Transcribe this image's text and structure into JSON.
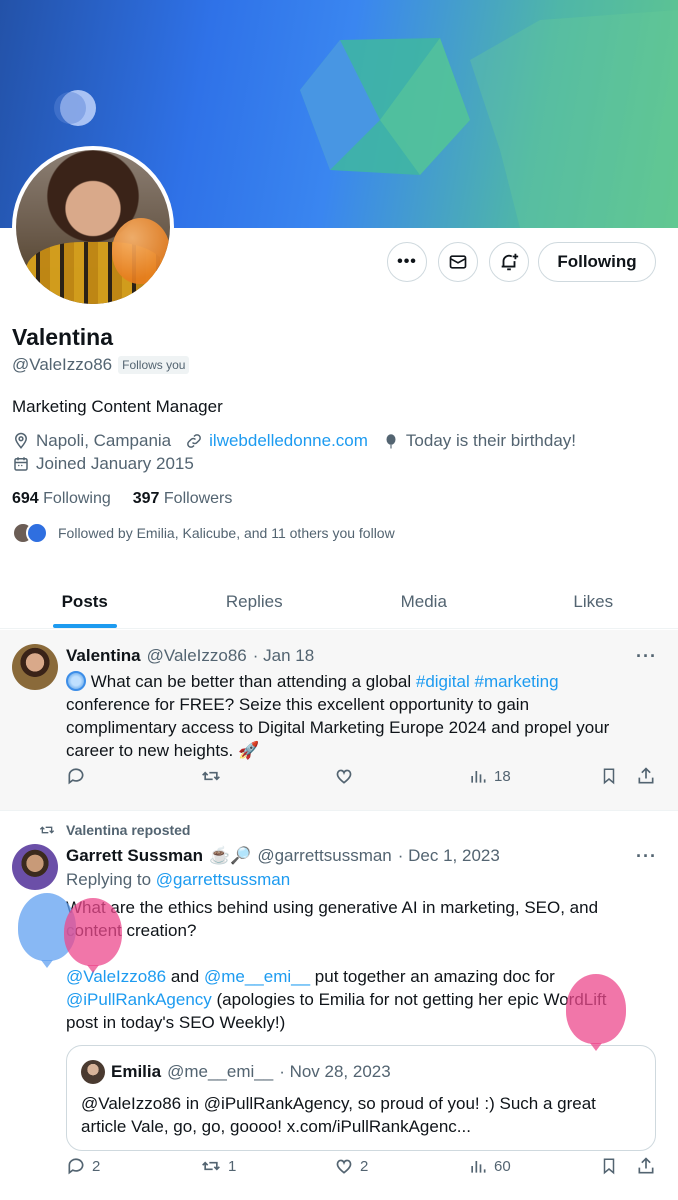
{
  "profile": {
    "name": "Valentina",
    "handle": "@ValeIzzo86",
    "follows_you": "Follows you",
    "bio": "Marketing Content Manager",
    "location": "Napoli, Campania",
    "website": "ilwebdelledonne.com",
    "birthday": "Today is their birthday!",
    "joined": "Joined January 2015",
    "following_count": "694",
    "following_label": "Following",
    "followers_count": "397",
    "followers_label": "Followers",
    "followed_by": "Followed by Emilia, Kalicube, and 11 others you follow",
    "following_button": "Following"
  },
  "tabs": [
    {
      "label": "Posts",
      "active": true
    },
    {
      "label": "Replies",
      "active": false
    },
    {
      "label": "Media",
      "active": false
    },
    {
      "label": "Likes",
      "active": false
    }
  ],
  "post1": {
    "author": "Valentina",
    "handle": "@ValeIzzo86",
    "date": "· Jan 18",
    "text_a": "What can be better than attending a global",
    "hashtag1": "#digital",
    "hashtag2": "#marketing",
    "text_b": "conference for FREE? Seize this excellent opportunity to gain",
    "text_c": "complimentary access to Digital Marketing Europe 2024 and propel your",
    "text_d": "career to new heights.",
    "emoji": "🚀",
    "views": "18"
  },
  "post2": {
    "reposted": "Valentina reposted",
    "author": "Garrett Sussman",
    "emojis": "☕️🔎",
    "handle": "@garrettsussman",
    "date": "· Dec 1, 2023",
    "replying_prefix": "Replying to",
    "replying_handle": "@garrettsussman",
    "line1": "What are the ethics behind using generative AI in marketing, SEO, and",
    "line2": "content creation?",
    "mention1": "@ValeIzzo86",
    "and": "and",
    "mention2": "@me__emi__",
    "line3_tail": "put together an amazing doc for",
    "mention3": "@iPullRankAgency",
    "line4_tail": "(apologies to Emilia for not getting her epic WordLift",
    "line5": "post in today's SEO Weekly!)",
    "replies": "2",
    "reposts": "1",
    "likes": "2",
    "views": "60"
  },
  "quote": {
    "author": "Emilia",
    "handle": "@me__emi__",
    "date": "· Nov 28, 2023",
    "line1": "@ValeIzzo86 in @iPullRankAgency, so proud of you! :)  Such a great",
    "line2": "article Vale, go, go, goooo! x.com/iPullRankAgenc..."
  },
  "colors": {
    "accent": "#1d9bf0",
    "text": "#0f1419",
    "muted": "#536471"
  }
}
